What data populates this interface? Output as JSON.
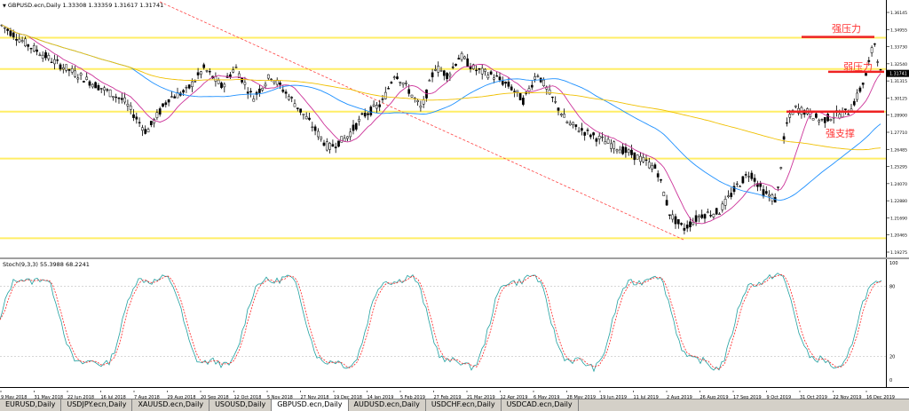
{
  "chart": {
    "symbol_title": "GBPUSD.ecn,Daily  1.33308 1.33359 1.31617 1.31741",
    "stoch_title": "Stoch(9,3,3) 55.3988 68.2241",
    "current_price": "1.31741",
    "annotations": {
      "strong_resistance": "强压力",
      "weak_resistance": "弱压力",
      "strong_support": "强支撑"
    }
  },
  "price_axis_labels": [
    "1.36145",
    "1.34955",
    "1.33730",
    "1.32540",
    "1.31315",
    "1.30125",
    "1.28900",
    "1.27710",
    "1.26485",
    "1.25295",
    "1.24070",
    "1.22880",
    "1.21690",
    "1.20465",
    "1.19275"
  ],
  "stoch_axis_labels": [
    "100",
    "80",
    "20",
    "0"
  ],
  "time_axis_labels": [
    "9 May 2018",
    "31 May 2018",
    "22 Jun 2018",
    "16 Jul 2018",
    "7 Aug 2018",
    "29 Aug 2018",
    "20 Sep 2018",
    "12 Oct 2018",
    "5 Nov 2018",
    "27 Nov 2018",
    "19 Dec 2018",
    "14 Jan 2019",
    "5 Feb 2019",
    "27 Feb 2019",
    "21 Mar 2019",
    "12 Apr 2019",
    "6 May 2019",
    "28 May 2019",
    "19 Jun 2019",
    "11 Jul 2019",
    "2 Aug 2019",
    "26 Aug 2019",
    "17 Sep 2019",
    "9 Oct 2019",
    "31 Oct 2019",
    "22 Nov 2019",
    "16 Dec 2019"
  ],
  "tabs": [
    {
      "label": "EURUSD,Daily",
      "active": false
    },
    {
      "label": "USDJPY.ecn,Daily",
      "active": false
    },
    {
      "label": "XAUUSD.ecn,Daily",
      "active": false
    },
    {
      "label": "USOUSD,Daily",
      "active": false
    },
    {
      "label": "GBPUSD.ecn,Daily",
      "active": true
    },
    {
      "label": "AUDUSD.ecn,Daily",
      "active": false
    },
    {
      "label": "USDCHF.ecn,Daily",
      "active": false
    },
    {
      "label": "USDCAD.ecn,Daily",
      "active": false
    }
  ],
  "colors": {
    "bull_candle": "#ffffff",
    "bear_candle": "#000000",
    "ma_fast": "#cc3399",
    "ma_mid": "#1e90ff",
    "ma_slow": "#f0c000",
    "horizontal_level": "#ffee66",
    "red_level": "#ee2222",
    "trendline": "#ff4444",
    "stoch_main": "#20a0a0",
    "stoch_signal": "#ff2222"
  },
  "price_levels": {
    "horizontal_lines": [
      1.3425,
      1.3205,
      1.2905,
      1.2575,
      1.2015
    ],
    "red_lines": [
      {
        "price": 1.343,
        "role": "strong_resistance"
      },
      {
        "price": 1.3185,
        "role": "weak_resistance"
      },
      {
        "price": 1.2905,
        "role": "strong_support"
      }
    ]
  }
}
